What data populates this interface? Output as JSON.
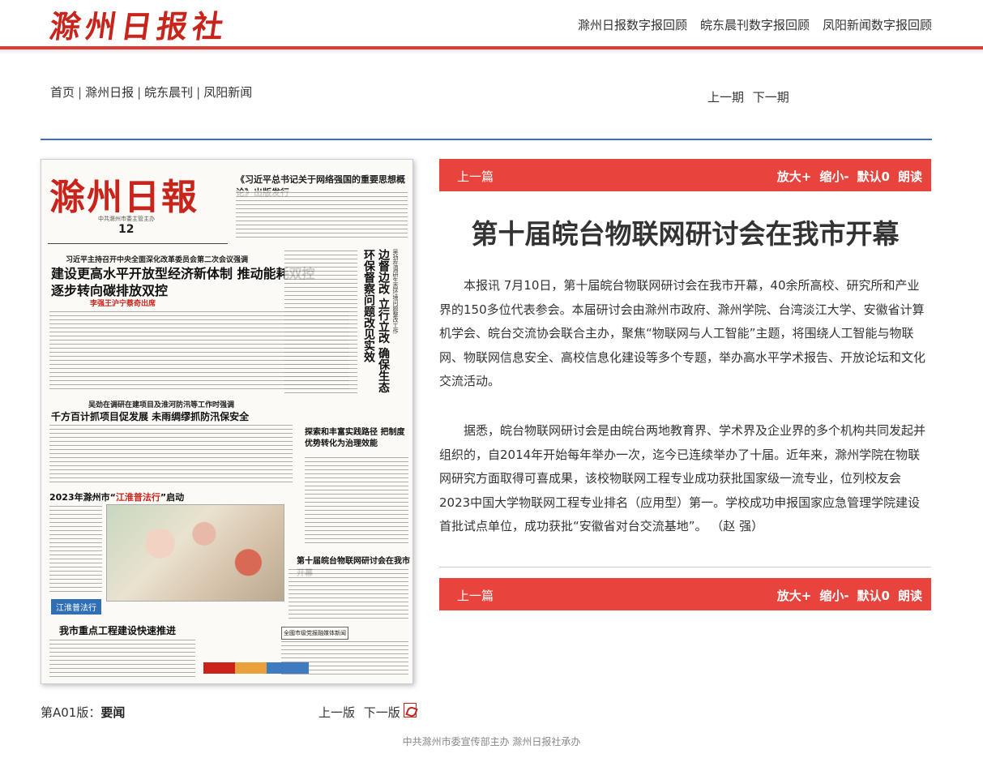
{
  "header": {
    "logo_text": "滁州日报社",
    "links": [
      "滁州日报数字报回顾",
      "皖东晨刊数字报回顾",
      "凤阳新闻数字报回顾"
    ]
  },
  "nav": {
    "breadcrumb": [
      "首页",
      "滁州日报",
      "皖东晨刊",
      "凤阳新闻"
    ],
    "prev_issue": "上一期",
    "next_issue": "下一期"
  },
  "paper_thumbnail": {
    "masthead": "滁州日報",
    "masthead_sub": "中共滁州市委主管主办",
    "issue_day": "12",
    "headline_top": "《习近平总书记关于网络强国的重要思想概论》出版发行",
    "lead_kicker": "习近平主持召开中央全面深化改革委员会第二次会议强调",
    "lead_headline": "建设更高水平开放型经济新体制 推动能耗双控逐步转向碳排放双控",
    "lead_sub": "李强王沪宁蔡奇出席",
    "vertical_headline": "边督边改 立行立改 确保生态环保督察问题改见实效",
    "vertical_kicker": "吴劲在调研生态环境问题整改工作",
    "second_kicker": "吴劲在调研在建项目及淮河防汛等工作时强调",
    "second_headline": "千方百计抓项目促发展 未雨绸缪抓防汛保安全",
    "right_headline": "探索和丰富实践路径 把制度优势转化为治理效能",
    "feature_headline": "2023年滁州市“江淮普法行”启动",
    "feature_highlight": "江淮普法行",
    "photo_tag": "江淮普法行",
    "bottom_headline": "我市重点工程建设快速推进",
    "iot_headline": "第十届皖台物联网研讨会在我市开幕",
    "box_headline": "全國市级党报融媒体新闻"
  },
  "page_label": {
    "prefix": "第A01版：",
    "name": "要闻"
  },
  "page_nav": {
    "prev": "上一版",
    "next": "下一版"
  },
  "article_bar": {
    "prev": "上一篇",
    "zoom_in": "放大+",
    "zoom_out": "缩小-",
    "default": "默认0",
    "read": "朗读"
  },
  "article": {
    "title": "第十届皖台物联网研讨会在我市开幕",
    "paragraphs": [
      "本报讯 7月10日，第十届皖台物联网研讨会在我市开幕，40余所高校、研究所和产业界的150多位代表参会。本届研讨会由滁州市政府、滁州学院、台湾淡江大学、安徽省计算机学会、皖台交流协会联合主办，聚焦“物联网与人工智能”主题，将围绕人工智能与物联网、物联网信息安全、高校信息化建设等多个专题，举办高水平学术报告、开放论坛和文化交流活动。",
      "据悉，皖台物联网研讨会是由皖台两地教育界、学术界及企业界的多个机构共同发起并组织的，自2014年开始每年举办一次，迄今已连续举办了十届。近年来，滁州学院在物联网研究方面取得可喜成果，该校物联网工程专业成功获批国家级一流专业，位列校友会2023中国大学物联网工程专业排名（应用型）第一。学校成功申报国家应急管理学院建设首批试点单位，成功获批“安徽省对台交流基地”。 （赵 强）"
    ]
  },
  "footer": "中共滁州市委宣传部主办 滁州日报社承办",
  "colors": {
    "brand_red": "#dd3b36",
    "bar_red": "#e8433c",
    "nav_blue": "#3b6fc4"
  }
}
